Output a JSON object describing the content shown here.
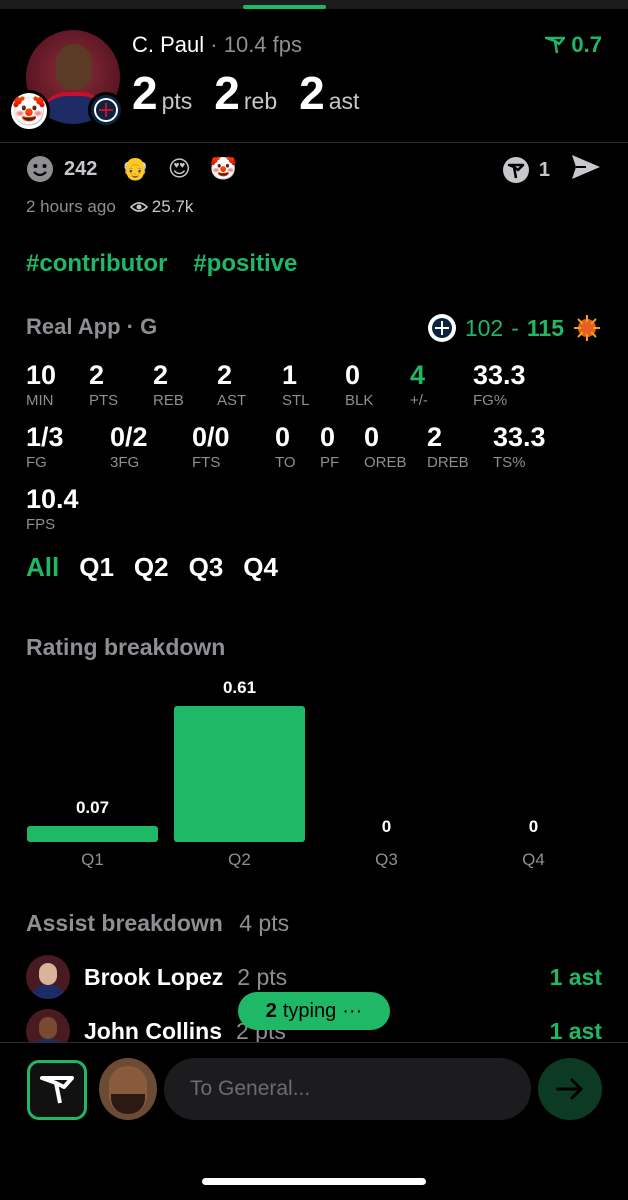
{
  "header": {
    "player_name": "C. Paul",
    "fps_label": "· 10.4 fps",
    "stats": [
      {
        "value": "2",
        "unit": "pts"
      },
      {
        "value": "2",
        "unit": "reb"
      },
      {
        "value": "2",
        "unit": "ast"
      }
    ],
    "rating": "0.7",
    "avatar_badge_emoji": "🤡"
  },
  "reactions": {
    "count": "242",
    "emojis": [
      "👴",
      "😍",
      "🤡"
    ],
    "comment_count": "1",
    "time_ago": "2 hours ago",
    "views": "25.7k"
  },
  "tags": [
    "#contributor",
    "#positive"
  ],
  "game": {
    "label": "Real App · G",
    "home_score": "102",
    "separator": "-",
    "away_score": "115"
  },
  "boxscore_row1": [
    {
      "value": "10",
      "label": "MIN"
    },
    {
      "value": "2",
      "label": "PTS"
    },
    {
      "value": "2",
      "label": "REB"
    },
    {
      "value": "2",
      "label": "AST"
    },
    {
      "value": "1",
      "label": "STL"
    },
    {
      "value": "0",
      "label": "BLK"
    },
    {
      "value": "4",
      "label": "+/-"
    },
    {
      "value": "33.3",
      "label": "FG%"
    }
  ],
  "boxscore_row2": [
    {
      "value": "1/3",
      "label": "FG"
    },
    {
      "value": "0/2",
      "label": "3FG"
    },
    {
      "value": "0/0",
      "label": "FTS"
    },
    {
      "value": "0",
      "label": "TO"
    },
    {
      "value": "0",
      "label": "PF"
    },
    {
      "value": "0",
      "label": "OREB"
    },
    {
      "value": "2",
      "label": "DREB"
    },
    {
      "value": "33.3",
      "label": "TS%"
    }
  ],
  "boxscore_row3": [
    {
      "value": "10.4",
      "label": "FPS"
    }
  ],
  "quarter_tabs": [
    "All",
    "Q1",
    "Q2",
    "Q3",
    "Q4"
  ],
  "rating_breakdown": {
    "title": "Rating breakdown"
  },
  "chart_data": {
    "type": "bar",
    "categories": [
      "Q1",
      "Q2",
      "Q3",
      "Q4"
    ],
    "values": [
      0.07,
      0.61,
      0,
      0
    ],
    "value_labels": [
      "0.07",
      "0.61",
      "0",
      "0"
    ],
    "title": "Rating breakdown",
    "color": "#1fb866"
  },
  "assist_breakdown": {
    "title": "Assist breakdown",
    "total": "4 pts",
    "rows": [
      {
        "name": "Brook Lopez",
        "pts": "2 pts",
        "ast": "1 ast"
      },
      {
        "name": "John Collins",
        "pts": "2 pts",
        "ast": "1 ast"
      }
    ]
  },
  "typing": {
    "count": "2",
    "label": "typing",
    "dots": "···"
  },
  "composer": {
    "placeholder": "To General..."
  },
  "colors": {
    "accent": "#1fb866",
    "background": "#000000",
    "muted": "#8e8e93"
  }
}
